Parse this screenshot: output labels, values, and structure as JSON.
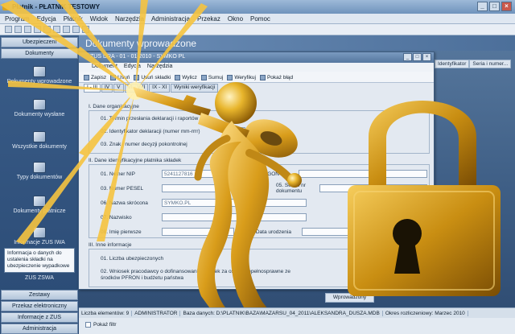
{
  "window": {
    "title": "Płatnik - PŁATNIK TESTOWY",
    "controls": [
      "_",
      "□",
      "×"
    ]
  },
  "menu": [
    "Program",
    "Edycja",
    "Płatnik",
    "Widok",
    "Narzędzia",
    "Administracja",
    "Przekaz",
    "Okno",
    "Pomoc"
  ],
  "sidebar": {
    "top_tabs": [
      "Ubezpieczeni",
      "Dokumenty"
    ],
    "items": [
      {
        "label": "Dokumenty wprowadzone",
        "icon": "document-icon"
      },
      {
        "label": "Dokumenty wysłane",
        "icon": "sent-document-icon"
      },
      {
        "label": "Wszystkie dokumenty",
        "icon": "all-documents-icon"
      },
      {
        "label": "Typy dokumentów",
        "icon": "document-types-icon"
      },
      {
        "label": "Dokumenty płatnicze",
        "icon": "payment-document-icon"
      },
      {
        "label": "Informacje ZUS IWA",
        "icon": "zus-iwa-icon"
      }
    ],
    "info_box": "Informacja o danych do ustalenia składki na ubezpieczenie wypadkowe",
    "zus_zswa": "ZUS ZSWA",
    "bottom_tabs": [
      "Zestawy",
      "Przekaz elektroniczny",
      "Informacje z ZUS",
      "Administracja"
    ]
  },
  "main": {
    "header": "Dokumenty wprowadzone",
    "column_headers": [
      "Identyfikator",
      "Seria i numer..."
    ],
    "status_label": "Wprowadzony"
  },
  "dialog": {
    "title": "ZUS DRA - 01 - 01-2010 - SYMKO PL",
    "controls": [
      "_",
      "□",
      "×"
    ],
    "menu": [
      "Dokument",
      "Edycja",
      "Narzędzia"
    ],
    "toolbar": [
      "Zapisz",
      "Usuń",
      "Usuń składki",
      "Wylicz",
      "Sumuj",
      "Weryfikuj",
      "Pokaż błąd"
    ],
    "tabs": [
      "I - III",
      "IV",
      "V",
      "VI - VIII",
      "IX - XI",
      "Wyniki weryfikacji"
    ],
    "section1": {
      "header": "I. Dane organizacyjne",
      "rows": [
        {
          "num": "01.",
          "label": "Termin przesłania deklaracji i raportów"
        },
        {
          "num": "02.",
          "label": "Identyfikator deklaracji (numer mm-rrrr)",
          "value": "01"
        },
        {
          "num": "03.",
          "label": "Znak i numer decyzji pokontrolnej"
        }
      ]
    },
    "section2": {
      "header": "II. Dane identyfikacyjne płatnika składek",
      "rows": [
        {
          "num": "01.",
          "label": "Numer NIP",
          "value": "5241127816"
        },
        {
          "num": "02.",
          "label": "Numer REGON"
        },
        {
          "num": "03.",
          "label": "Numer PESEL"
        },
        {
          "num": "04.",
          "label": "Rodzaj dokumentu"
        },
        {
          "num": "05.",
          "label": "Seria i nr dokumentu"
        },
        {
          "num": "06.",
          "label": "Nazwa skrócona",
          "value": "SYMKO.PL"
        },
        {
          "num": "07.",
          "label": "Nazwisko"
        },
        {
          "num": "08.",
          "label": "Imię pierwsze"
        },
        {
          "num": "09.",
          "label": "Data urodzenia"
        }
      ]
    },
    "section3": {
      "header": "III. Inne informacje",
      "rows": [
        {
          "num": "01.",
          "label": "Liczba ubezpieczonych"
        },
        {
          "num": "02.",
          "label": "Wniosek pracodawcy o dofinansowanie składek za osoby niepełnosprawne ze środków PFRON i budżetu państwa"
        }
      ]
    }
  },
  "status_bar": [
    "Liczba elementów: 9",
    "ADMINISTRATOR",
    "Baza danych: D:\\PLATNIK\\BAZA\\MAZARSU_04_2011\\ALEKSANDRA_DUSZA.MDB",
    "Okres rozliczeniowy: Marzec 2010"
  ],
  "filter_label": "Pokaż filtr",
  "colors": {
    "lock_gold": "#d4a017",
    "figure_gold": "#e0ab22",
    "sidebar_bg": "#2f5079",
    "accent_blue": "#55779f"
  }
}
